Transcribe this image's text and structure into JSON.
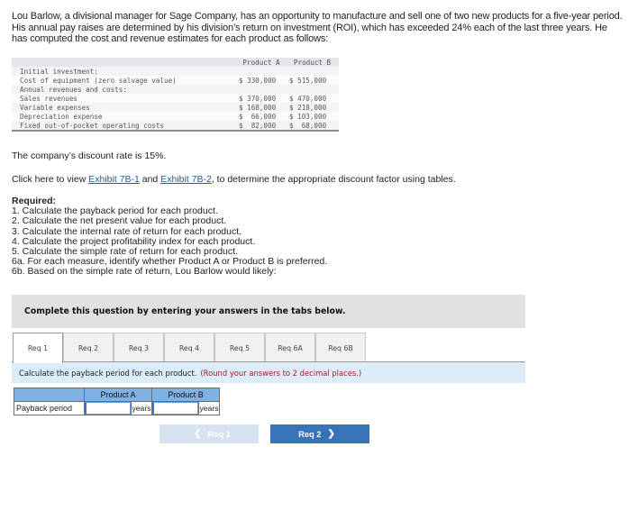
{
  "intro_text": "Lou Barlow, a divisional manager for Sage Company, has an opportunity to manufacture and sell one of two new products for a five-year period. His annual pay raises are determined by his division’s return on investment (ROI), which has exceeded 24% each of the last three years. He has computed the cost and revenue estimates for each product as follows:",
  "cost_table": {
    "headers": [
      "",
      "Product A",
      "Product B"
    ],
    "rows": [
      {
        "label": "Initial investment:",
        "a": "",
        "b": ""
      },
      {
        "label": "Cost of equipment (zero salvage value)",
        "a": "$ 330,000",
        "b": "$ 515,000"
      },
      {
        "label": "Annual revenues and costs:",
        "a": "",
        "b": ""
      },
      {
        "label": "Sales revenues",
        "a": "$ 370,000",
        "b": "$ 470,000"
      },
      {
        "label": "Variable expenses",
        "a": "$ 168,000",
        "b": "$ 218,000"
      },
      {
        "label": "Depreciation expense",
        "a": "$  66,000",
        "b": "$ 103,000"
      },
      {
        "label": "Fixed out-of-pocket operating costs",
        "a": "$  82,000",
        "b": "$  68,000"
      }
    ]
  },
  "discount_text": "The company’s discount rate is 15%.",
  "exhibit": {
    "prefix": "Click here to view ",
    "link1": "Exhibit 7B-1",
    "middle": " and ",
    "link2": "Exhibit 7B-2",
    "suffix": ", to determine the appropriate discount factor using tables."
  },
  "required": {
    "title": "Required:",
    "items": [
      "1. Calculate the payback period for each product.",
      "2. Calculate the net present value for each product.",
      "3. Calculate the internal rate of return for each product.",
      "4. Calculate the project profitability index for each product.",
      "5. Calculate the simple rate of return for each product.",
      "6a. For each measure, identify whether Product A or Product B is preferred.",
      "6b. Based on the simple rate of return, Lou Barlow would likely:"
    ]
  },
  "panel": {
    "header": "Complete this question by entering your answers in the tabs below.",
    "tabs": [
      {
        "label": "Req 1",
        "active": true
      },
      {
        "label": "Req 2",
        "active": false
      },
      {
        "label": "Req 3",
        "active": false
      },
      {
        "label": "Req 4",
        "active": false
      },
      {
        "label": "Req 5",
        "active": false
      },
      {
        "label": "Req 6A",
        "active": false
      },
      {
        "label": "Req 6B",
        "active": false
      }
    ],
    "instruction": "Calculate the payback period for each product.",
    "instruction_note": "(Round your answers to 2 decimal places.)"
  },
  "answer_table": {
    "col_a": "Product A",
    "col_b": "Product B",
    "row_label": "Payback period",
    "unit": "years",
    "value_a": "",
    "value_b": ""
  },
  "nav": {
    "prev_label": "Req 1",
    "next_label": "Req 2",
    "prev_icon": "chevron-left-icon",
    "next_icon": "chevron-right-icon"
  },
  "colors": {
    "link": "#1a5ea8",
    "note_red": "#a0202a",
    "next_button": "#3873b8",
    "prev_button_disabled": "#d6e2ef",
    "table_header_blue": "#7fb1e3",
    "instruction_bg": "#dcecf9"
  }
}
